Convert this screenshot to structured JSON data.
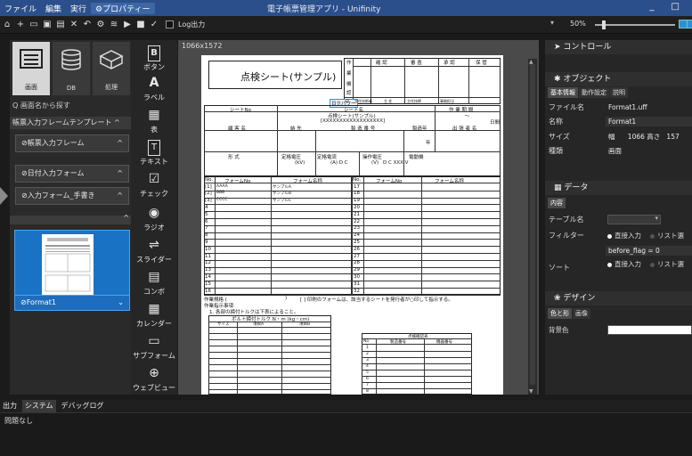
{
  "titlebar": {
    "menus": [
      "ファイル",
      "編集",
      "実行",
      "⚙プロパティー"
    ],
    "title": "電子帳票管理アプリ - Unifinity",
    "window_controls": "_ □"
  },
  "toolbar": {
    "log_label": "Log出力",
    "zoom": "50%"
  },
  "leftpanel": {
    "icons": [
      {
        "label": "画面",
        "icon": "screen-icon"
      },
      {
        "label": "DB",
        "icon": "database-icon"
      },
      {
        "label": "処理",
        "icon": "process-icon"
      }
    ],
    "search_label": "Q 画面名から探す",
    "template_header": "帳票入力フレームテンプレート ^",
    "items": [
      "⊘帳票入力フレーム",
      "⊘日付入力フォーム",
      "⊘入力フォーム_手書き"
    ],
    "selected_format": "⊘Format1"
  },
  "tools": [
    {
      "label": "ボタン",
      "icon": "B"
    },
    {
      "label": "ラベル",
      "icon": "A"
    },
    {
      "label": "表",
      "icon": "▦"
    },
    {
      "label": "テキスト",
      "icon": "T"
    },
    {
      "label": "チェック",
      "icon": "☑"
    },
    {
      "label": "ラジオ",
      "icon": "◉"
    },
    {
      "label": "スライダー",
      "icon": "⇌"
    },
    {
      "label": "コンボ",
      "icon": "▤"
    },
    {
      "label": "カレンダー",
      "icon": "▦"
    },
    {
      "label": "サブフォーム",
      "icon": "▭"
    },
    {
      "label": "ウェブビュー",
      "icon": "⊕"
    }
  ],
  "canvas": {
    "size": "1066x1572"
  },
  "sheet": {
    "title": "点検シート(サンプル)",
    "approval_headers": [
      "作",
      "確 認",
      "審 査",
      "承 認",
      "保 管"
    ],
    "approval_side": [
      "業",
      "機",
      "認"
    ],
    "company": "日立パワー",
    "roles": [
      "印",
      "主任技術者",
      "主 任",
      "主任技師",
      "事務担当"
    ],
    "sheet_no_label": "シートNo",
    "sheet_name_label": "シート名",
    "sheet_name": "点検シート(サンプル)",
    "placeholder": "[XXXXXXXXXXXXXXXXXX]",
    "work_period": "作 業 期 間",
    "tilde": "〜",
    "day": "日間",
    "customer": "顧 客 名",
    "delivery": "納 先",
    "product_no": "製 造 番 号",
    "mfg_year": "製造年",
    "year": "年",
    "staff": "出 張 者 名",
    "format_label": "形 式",
    "rated_voltage": "定格電圧",
    "rated_current": "定格電流",
    "op_voltage": "操作電圧",
    "motor": "電動機",
    "kv": "(kV)",
    "a_dc": "(A) D C",
    "v": "(V)",
    "dc_v": "D C XXX V",
    "col_no": "No.",
    "col_form_no": "フォームNo",
    "col_form_name": "フォーム名称",
    "rows_left": [
      {
        "no": "[1]",
        "code": "AAAA",
        "name": "サンプルA"
      },
      {
        "no": "[2]",
        "code": "BBB",
        "name": "サンプルB"
      },
      {
        "no": "[3]",
        "code": "CCCC",
        "name": "サンプルC"
      },
      {
        "no": "4",
        "code": "",
        "name": ""
      },
      {
        "no": "5",
        "code": "",
        "name": ""
      },
      {
        "no": "6",
        "code": "",
        "name": ""
      },
      {
        "no": "7",
        "code": "",
        "name": ""
      },
      {
        "no": "8",
        "code": "",
        "name": ""
      },
      {
        "no": "9",
        "code": "",
        "name": ""
      },
      {
        "no": "10",
        "code": "",
        "name": ""
      },
      {
        "no": "11",
        "code": "",
        "name": ""
      },
      {
        "no": "12",
        "code": "",
        "name": ""
      },
      {
        "no": "13",
        "code": "",
        "name": ""
      },
      {
        "no": "14",
        "code": "",
        "name": ""
      },
      {
        "no": "15",
        "code": "",
        "name": ""
      },
      {
        "no": "16",
        "code": "",
        "name": ""
      }
    ],
    "rows_right": [
      "17",
      "18",
      "19",
      "20",
      "21",
      "22",
      "23",
      "24",
      "25",
      "26",
      "27",
      "28",
      "29",
      "30",
      "31",
      "32"
    ],
    "work_spec": "作業規格 (",
    "work_spec_paren": ")",
    "print_note": "[ ] 印刷のフォームは、該当するシートを発行者が○印して指示する。",
    "instructions": "作業指示事項",
    "torque_note": "1. 各部の締付トルクは下表によること。",
    "torque_header": "ボルト締付トルク N・m (kg・cm)",
    "torque_cols": [
      "サイズ",
      "項目A",
      "項目B"
    ],
    "checklist_title": "点検確認表",
    "checklist_cols": [
      "No",
      "製造番号",
      "機器番号"
    ],
    "checklist_rows": [
      "1",
      "2",
      "3",
      "4",
      "5",
      "6",
      "7",
      "8"
    ]
  },
  "rightpanel": {
    "control_header": "コントロール",
    "object_header": "オブジェクト",
    "object_tabs": [
      "基本情報",
      "動作設定",
      "説明"
    ],
    "props": [
      {
        "label": "ファイル名",
        "value": "Format1.uff"
      },
      {
        "label": "名称",
        "value": "Format1"
      },
      {
        "label": "サイズ",
        "value": "幅      1066 高さ   157"
      },
      {
        "label": "種類",
        "value": "画面"
      }
    ],
    "data_header": "データ",
    "data_tab": "内容",
    "table_label": "テーブル名",
    "filter_label": "フィルター",
    "direct_input": "直接入力",
    "list_select": "リスト選",
    "filter_value": "before_flag = 0",
    "sort_label": "ソート",
    "design_header": "デザイン",
    "design_tabs": [
      "色と形",
      "画像"
    ],
    "bg_label": "背景色"
  },
  "bottom": {
    "tabs": [
      "出力",
      "システム",
      "デバッグログ"
    ],
    "output": "問題なし"
  }
}
